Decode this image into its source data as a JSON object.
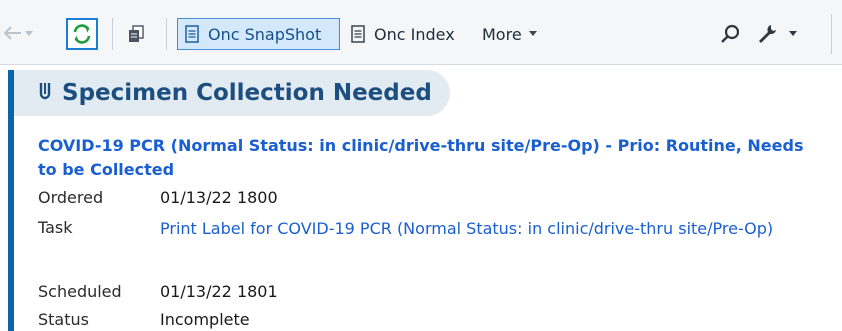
{
  "toolbar": {
    "buttons": [
      {
        "label": "Onc SnapShot",
        "icon": "document-icon"
      },
      {
        "label": "Onc Index",
        "icon": "document-icon"
      },
      {
        "label": "More",
        "icon": "caret-down-icon"
      }
    ],
    "icons": [
      "back-arrow-icon",
      "refresh-icon",
      "copy-icon",
      "search-icon",
      "wrench-icon"
    ]
  },
  "section": {
    "title": "Specimen Collection Needed",
    "icon": "specimen-tube-icon"
  },
  "order": {
    "title": "COVID-19 PCR (Normal Status: in clinic/drive-thru site/Pre-Op) - Prio: Routine, Needs to be Collected",
    "details": [
      {
        "label": "Ordered",
        "value": "01/13/22 1800"
      },
      {
        "label": "Task",
        "value": "Print Label for COVID-19 PCR (Normal Status: in clinic/drive-thru site/Pre-Op)"
      },
      {
        "label": "Scheduled",
        "value": "01/13/22 1801"
      },
      {
        "label": "Status",
        "value": "Incomplete"
      }
    ]
  },
  "colors": {
    "accent": "#0b64a8",
    "link": "#1a5fd1",
    "selected_button_bg": "#d4e8fb",
    "refresh_green": "#1e9e3c"
  }
}
